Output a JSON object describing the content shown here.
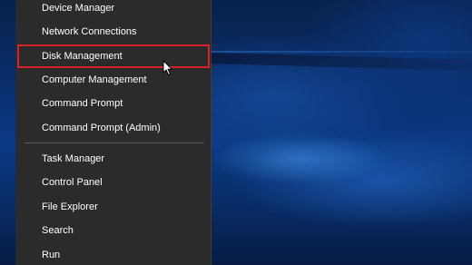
{
  "context_menu": {
    "items": [
      {
        "label": "Device Manager"
      },
      {
        "label": "Network Connections"
      },
      {
        "label": "Disk Management",
        "highlighted": true
      },
      {
        "label": "Computer Management"
      },
      {
        "label": "Command Prompt"
      },
      {
        "label": "Command Prompt (Admin)"
      },
      {
        "label": "Task Manager"
      },
      {
        "label": "Control Panel"
      },
      {
        "label": "File Explorer"
      },
      {
        "label": "Search"
      },
      {
        "label": "Run"
      }
    ],
    "highlight_color": "#d4232b",
    "background_color": "#2b2b2b"
  },
  "desktop": {
    "wallpaper": "Windows 10 blue light wallpaper"
  },
  "cursor": {
    "icon": "arrow-pointer-icon"
  }
}
